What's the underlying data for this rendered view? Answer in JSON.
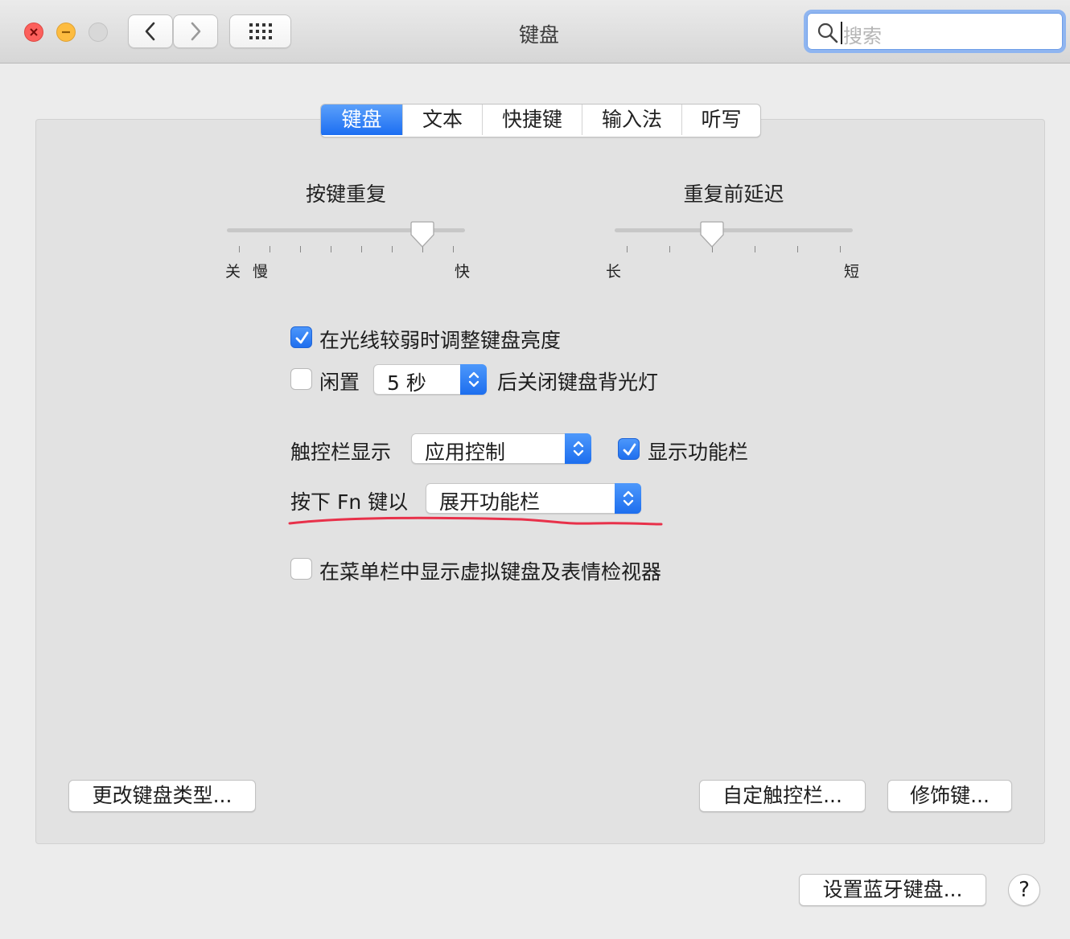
{
  "window": {
    "title": "键盘",
    "search": {
      "placeholder": "搜索",
      "value": ""
    }
  },
  "tabs": [
    {
      "label": "键盘",
      "active": true
    },
    {
      "label": "文本",
      "active": false
    },
    {
      "label": "快捷键",
      "active": false
    },
    {
      "label": "输入法",
      "active": false
    },
    {
      "label": "听写",
      "active": false
    }
  ],
  "key_repeat": {
    "title": "按键重复",
    "label_off": "关",
    "label_slow": "慢",
    "label_fast": "快",
    "position_fraction": 0.82
  },
  "delay_until_repeat": {
    "title": "重复前延迟",
    "label_long": "长",
    "label_short": "短",
    "position_fraction": 0.4
  },
  "options": {
    "adjust_brightness": {
      "label": "在光线较弱时调整键盘亮度",
      "checked": true
    },
    "idle": {
      "checked": false,
      "label_before": "闲置",
      "popup_value": "5 秒",
      "label_after": "后关闭键盘背光灯"
    },
    "touchbar_shows": {
      "label": "触控栏显示",
      "popup_value": "应用控制"
    },
    "show_control_strip": {
      "label": "显示功能栏",
      "checked": true
    },
    "press_fn": {
      "label": "按下 Fn 键以",
      "popup_value": "展开功能栏"
    },
    "show_keyboard_viewer": {
      "label": "在菜单栏中显示虚拟键盘及表情检视器",
      "checked": false
    }
  },
  "buttons": {
    "change_keyboard_type": "更改键盘类型...",
    "customize_touchbar": "自定触控栏...",
    "modifier_keys": "修饰键...",
    "setup_bluetooth_keyboard": "设置蓝牙键盘...",
    "help": "?"
  },
  "colors": {
    "accent_blue": "#1c6ef2",
    "annotation_red": "#e8314a",
    "close_red": "#fc605c",
    "minimize_yellow": "#fdbc40"
  }
}
